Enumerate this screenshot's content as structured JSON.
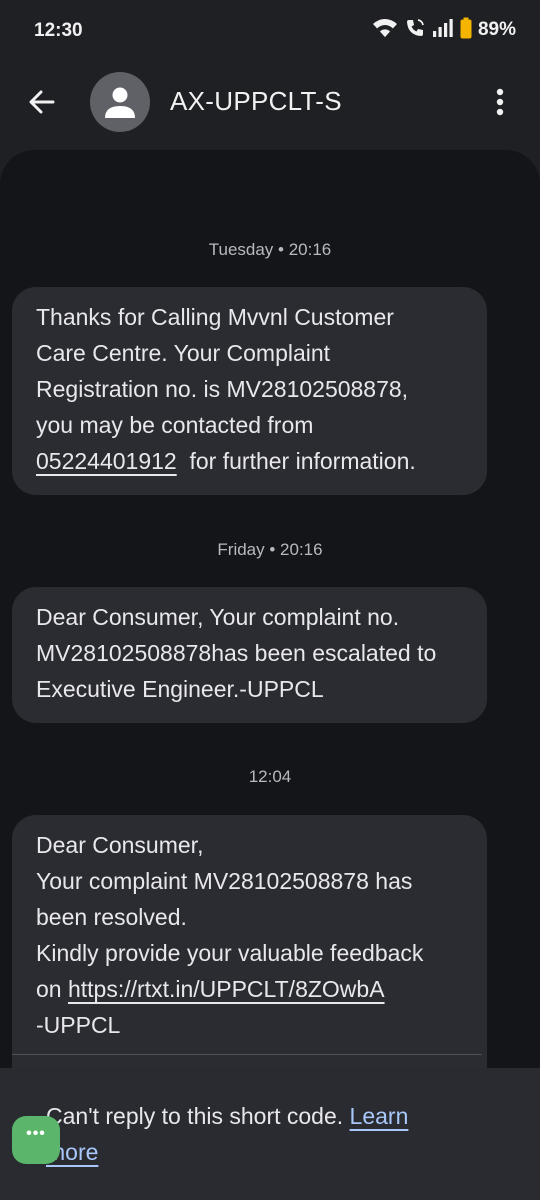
{
  "status": {
    "time": "12:30",
    "battery": "89%",
    "icons": [
      "wifi-icon",
      "wifi-calling-icon",
      "signal-icon",
      "battery-icon"
    ]
  },
  "header": {
    "title": "AX-UPPCLT-S",
    "icons": [
      "back-arrow-icon",
      "person-icon",
      "more-vert-icon"
    ]
  },
  "messages": [
    {
      "timestamp": "Tuesday • 20:16",
      "lines": [
        "Thanks for Calling Mvvnl Customer",
        "Care Centre. Your Complaint",
        "Registration no. is MV28102508878,",
        "you may be contacted from"
      ],
      "phone": "05224401912",
      "after_phone": "  for further information."
    },
    {
      "timestamp": "Friday • 20:16",
      "lines": [
        "Dear Consumer, Your complaint no.",
        "MV28102508878has been escalated to",
        "Executive Engineer.-UPPCL"
      ]
    },
    {
      "timestamp": "12:04",
      "lines": [
        "Dear Consumer,",
        "Your complaint MV28102508878 has",
        "been resolved.",
        "Kindly provide your valuable feedback"
      ],
      "link_prefix": "on ",
      "link": "https://rtxt.in/UPPCLT/8ZOwbA",
      "last_line": "-UPPCL"
    }
  ],
  "notice": {
    "text": "Can't reply to this short code. ",
    "link": "Learn more"
  },
  "fab": {
    "label": "•••",
    "color": "#5bb56a"
  },
  "colors": {
    "background": "#1f2024",
    "panel": "#141519",
    "bubble": "#2b2c31",
    "link_accent": "#a8c7fa",
    "battery": "#f4b400"
  }
}
